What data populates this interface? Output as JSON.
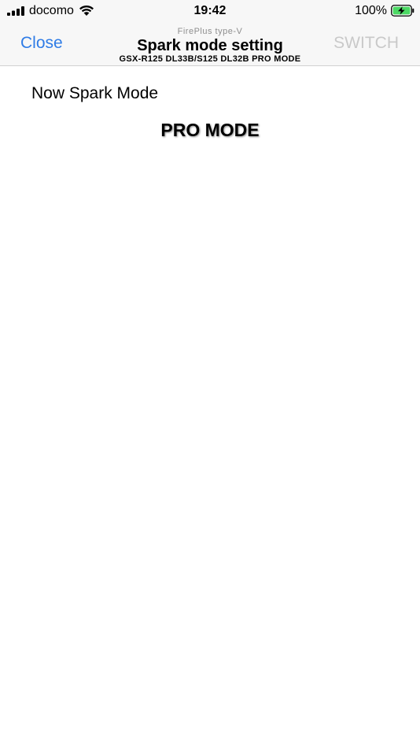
{
  "status_bar": {
    "carrier": "docomo",
    "time": "19:42",
    "battery_percent": "100%",
    "icons": [
      "signal-icon",
      "wifi-icon",
      "battery-charging-icon"
    ]
  },
  "nav": {
    "close_label": "Close",
    "switch_label": "SWITCH",
    "supertitle": "FirePlus type-V",
    "title": "Spark mode setting",
    "subtitle": "GSX-R125 DL33B/S125 DL32B PRO MODE"
  },
  "content": {
    "now_mode_label": "Now Spark Mode",
    "now_mode_value": "PRO MODE"
  },
  "colors": {
    "accent": "#2f7ce6",
    "disabled": "#c9c9c9",
    "battery_green": "#4cd964"
  }
}
